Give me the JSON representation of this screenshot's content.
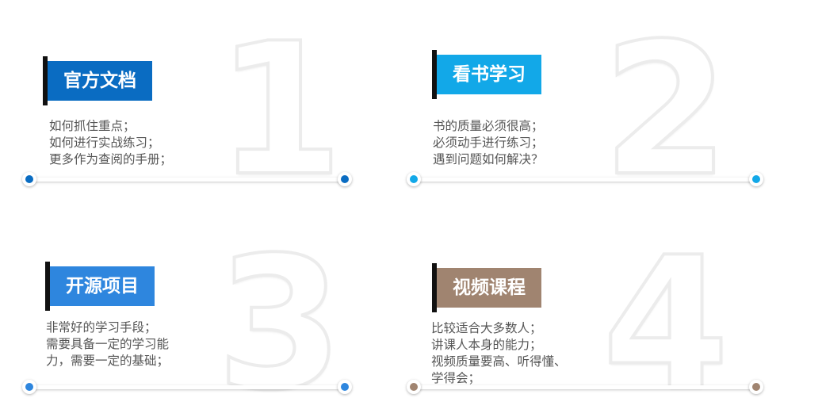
{
  "colors": {
    "blue_dark": "#0A6CC2",
    "blue_light": "#12A8E8",
    "blue_mid": "#2E86DE",
    "brown": "#A08470"
  },
  "cards": [
    {
      "number": "1",
      "title": "官方文档",
      "lines": [
        "如何抓住重点；",
        "如何进行实战练习；",
        "更多作为查阅的手册；"
      ]
    },
    {
      "number": "2",
      "title": "看书学习",
      "lines": [
        "书的质量必须很高；",
        "必须动手进行练习；",
        "遇到问题如何解决？"
      ]
    },
    {
      "number": "3",
      "title": "开源项目",
      "lines": [
        "非常好的学习手段；",
        "需要具备一定的学习能",
        "力，需要一定的基础；"
      ]
    },
    {
      "number": "4",
      "title": "视频课程",
      "lines": [
        "比较适合大多数人；",
        "讲课人本身的能力；",
        "视频质量要高、听得懂、",
        "学得会；"
      ]
    }
  ]
}
